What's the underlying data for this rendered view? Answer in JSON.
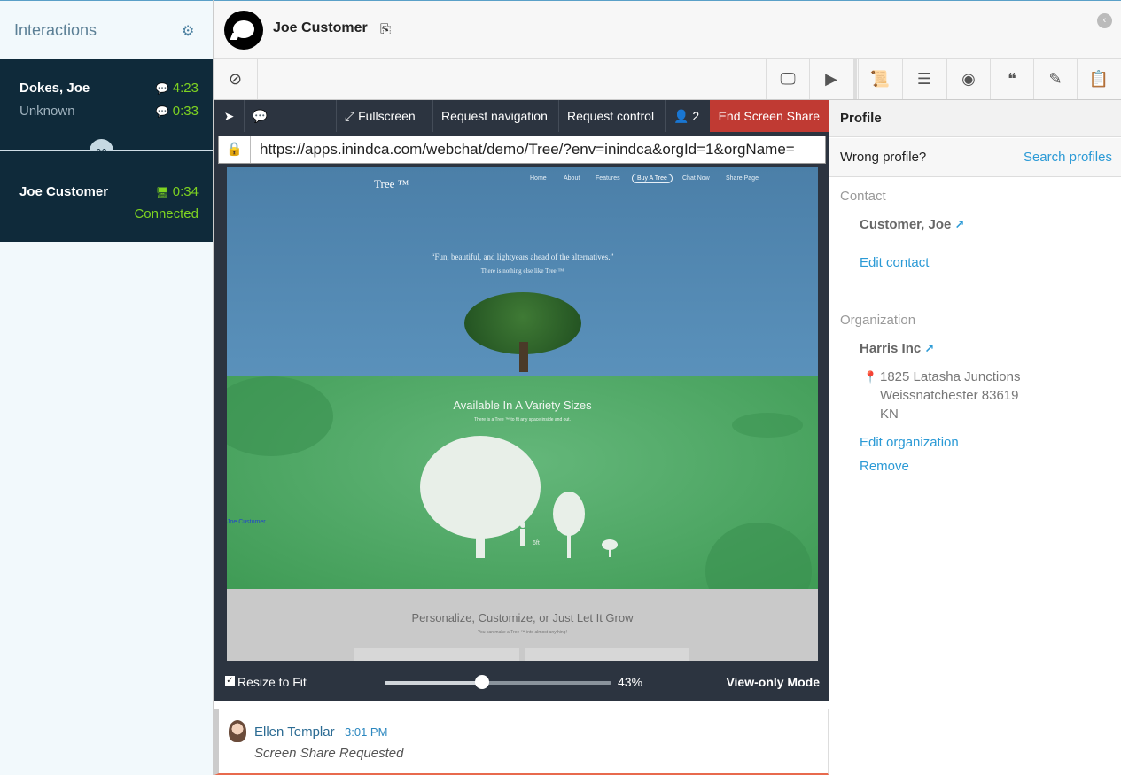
{
  "sidebar": {
    "title": "Interactions",
    "conversations": [
      {
        "name": "Dokes, Joe",
        "sub": "Unknown",
        "time1": "4:23",
        "time2": "0:33"
      },
      {
        "name": "Joe Customer",
        "time": "0:34",
        "status": "Connected"
      }
    ]
  },
  "header": {
    "customer_name": "Joe Customer"
  },
  "screenshare": {
    "fullscreen": "Fullscreen",
    "request_navigation": "Request navigation",
    "request_control": "Request control",
    "participants": "2",
    "end_label": "End Screen Share",
    "url": "https://apps.inindca.com/webchat/demo/Tree/?env=inindca&orgId=1&orgName=",
    "resize_label": "Resize to Fit",
    "zoom": "43%",
    "zoom_value": 43,
    "mode": "View-only Mode",
    "site": {
      "logo": "Tree ™",
      "nav": [
        "Home",
        "About",
        "Features",
        "Buy A Tree",
        "Chat Now",
        "Share Page"
      ],
      "quote": "“Fun, beautiful, and lightyears ahead of the alternatives.”",
      "quote_sub": "There is nothing else like    Tree ™",
      "green_title": "Available In A Variety Sizes",
      "green_sub": "There is a Tree ™ to fit any space inside and out.",
      "cursor_label": "Joe Customer",
      "height_label": "6ft",
      "grey_title": "Personalize, Customize, or Just Let It Grow",
      "grey_sub": "You can make a Tree ™ into almost anything!"
    }
  },
  "chat": {
    "author": "Ellen Templar",
    "time": "3:01 PM",
    "message": "Screen Share Requested"
  },
  "profile": {
    "title": "Profile",
    "wrong_profile": "Wrong profile?",
    "search_profiles": "Search profiles",
    "contact_section": "Contact",
    "contact_name": "Customer, Joe",
    "edit_contact": "Edit contact",
    "org_section": "Organization",
    "org_name": "Harris Inc",
    "address_line1": "1825 Latasha Junctions",
    "address_line2": "Weissnatchester 83619",
    "address_line3": "KN",
    "edit_org": "Edit organization",
    "remove": "Remove"
  },
  "colors": {
    "accent": "#2b9ad6",
    "status_green": "#7ed321",
    "end_share_red": "#c03a33",
    "sidebar_dark": "#0f2a3a"
  }
}
